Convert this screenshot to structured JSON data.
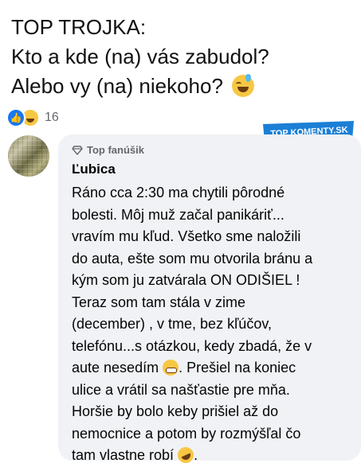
{
  "post": {
    "lines": [
      "TOP TROJKA:",
      "Kto a kde (na) vás zabudol?",
      "Alebo vy (na) niekoho?"
    ]
  },
  "reactions": {
    "count": "16",
    "icons": [
      "like-icon",
      "haha-icon"
    ]
  },
  "watermark": {
    "text": "TOP KOMENTY.SK",
    "colors": {
      "fill": "#1b7fd6",
      "text": "#ffffff"
    }
  },
  "comment": {
    "badge": "Top fanúšik",
    "author": "Ľubica",
    "lines": [
      "Ráno cca 2:30 ma chytili pôrodné",
      "bolesti. Môj muž začal panikáriť...",
      "vravím mu kľud. Všetko sme naložili",
      "do auta, ešte som mu otvorila bránu a",
      "kým som ju zatvárala ON ODIŠIEL !",
      "Teraz som tam stála v zime",
      "(december) , v tme, bez kľúčov,",
      "telefónu...s otázkou, kedy zbadá, že v",
      "aute nesedím",
      ". Prešiel na koniec",
      "ulice a vrátil sa našťastie pre mňa.",
      "Horšie by bolo keby prišiel až do",
      "nemocnice a potom by rozmýšľal čo",
      "tam vlastne robí",
      "."
    ]
  },
  "colors": {
    "bubble": "#f0f2f5",
    "meta": "#65676b",
    "like": "#1877f2",
    "emoji": "#f7c744"
  }
}
